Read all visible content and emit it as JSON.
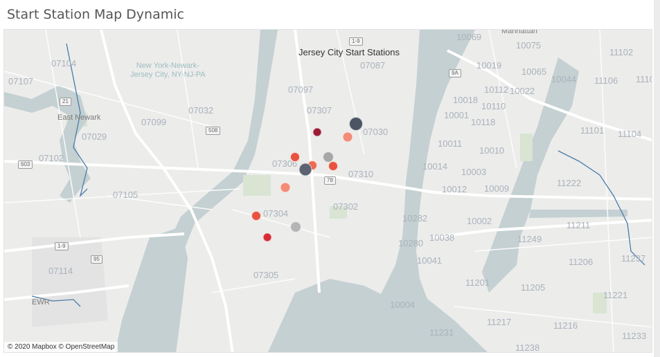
{
  "title": "Start Station Map Dynamic",
  "map": {
    "overlay_title": "Jersey City Start Stations",
    "attribution": "© 2020 Mapbox © OpenStreetMap",
    "colors": {
      "water": "#c4d0d2",
      "land": "#ececeb",
      "road": "#ffffff",
      "park": "#d9e4d3"
    },
    "place_labels": [
      {
        "id": "manhattan",
        "text": "Manhattan"
      },
      {
        "id": "east-newark",
        "text": "East Newark"
      },
      {
        "id": "ewr",
        "text": "EWR"
      },
      {
        "id": "airport",
        "text": "New York-Newark-\nJersey City, NY-NJ-PA"
      }
    ],
    "zip_labels": [
      "10069",
      "10075",
      "11102",
      "07104",
      "07087",
      "10019",
      "10065",
      "10044",
      "11106",
      "1110",
      "07107",
      "07097",
      "10112",
      "10022",
      "10018",
      "10110",
      "07032",
      "07307",
      "10001",
      "10118",
      "07099",
      "07029",
      "07030",
      "11101",
      "11104",
      "10011",
      "10010",
      "07102",
      "07306",
      "10014",
      "10003",
      "07310",
      "11222",
      "07105",
      "10012",
      "10009",
      "07302",
      "07304",
      "10282",
      "10002",
      "11211",
      "10280",
      "10038",
      "11249",
      "10041",
      "11206",
      "11237",
      "07114",
      "07305",
      "11201",
      "11205",
      "11221",
      "10004",
      "11217",
      "11216",
      "11231",
      "11233",
      "11238"
    ],
    "road_shields": [
      "1-9",
      "9A",
      "21",
      "508",
      "603",
      "78",
      "1-9",
      "95"
    ],
    "stations": [
      {
        "color": "#9b1a34"
      },
      {
        "color": "#4d5564"
      },
      {
        "color": "#f38c76"
      },
      {
        "color": "#e8533f"
      },
      {
        "color": "#ee6a50"
      },
      {
        "color": "#a7a7a7"
      },
      {
        "color": "#e8533f"
      },
      {
        "color": "#5b6370"
      },
      {
        "color": "#f38c76"
      },
      {
        "color": "#e8533f"
      },
      {
        "color": "#b5b5b5"
      },
      {
        "color": "#d62c34"
      }
    ]
  }
}
